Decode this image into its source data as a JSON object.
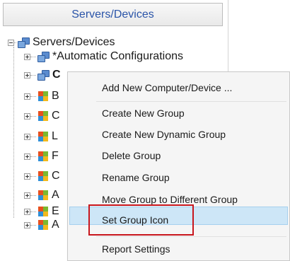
{
  "panel": {
    "header": "Servers/Devices"
  },
  "tree": {
    "root_label": "Servers/Devices",
    "children": [
      {
        "label": "*Automatic Configurations",
        "icon": "server-icon"
      },
      {
        "label": "C",
        "icon": "server-icon"
      },
      {
        "label": "B",
        "icon": "windows-group-icon"
      },
      {
        "label": "C",
        "icon": "windows-group-icon"
      },
      {
        "label": "L",
        "icon": "windows-group-icon"
      },
      {
        "label": "F",
        "icon": "windows-group-icon"
      },
      {
        "label": "C",
        "icon": "windows-group-icon"
      },
      {
        "label": "A",
        "icon": "windows-group-icon"
      },
      {
        "label": "E",
        "icon": "windows-group-icon"
      },
      {
        "label": "A",
        "icon": "windows-group-icon"
      }
    ]
  },
  "context_menu": {
    "items": [
      {
        "label": "Add New Computer/Device ..."
      },
      {
        "label": "Create New Group"
      },
      {
        "label": "Create New Dynamic Group"
      },
      {
        "label": "Delete Group"
      },
      {
        "label": "Rename Group"
      },
      {
        "label": "Move Group to Different Group"
      },
      {
        "label": "Set Group Icon",
        "highlighted": true
      },
      {
        "label": "Report Settings"
      }
    ]
  },
  "colors": {
    "header_text": "#2a54a8",
    "highlight": "#cde6f7",
    "annotation": "#c8161d"
  }
}
